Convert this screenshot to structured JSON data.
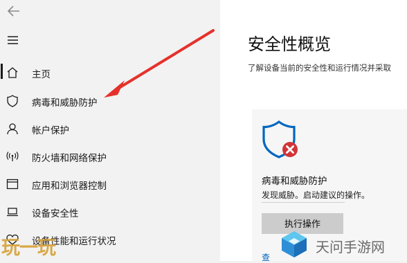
{
  "sidebar": {
    "back_icon": "back-arrow-icon",
    "menu_icon": "hamburger-menu-icon",
    "items": [
      {
        "label": "主页",
        "icon": "home-icon",
        "active": true
      },
      {
        "label": "病毒和威胁防护",
        "icon": "shield-icon"
      },
      {
        "label": "帐户保护",
        "icon": "person-icon"
      },
      {
        "label": "防火墙和网络保护",
        "icon": "wifi-antenna-icon"
      },
      {
        "label": "应用和浏览器控制",
        "icon": "app-window-icon"
      },
      {
        "label": "设备安全性",
        "icon": "laptop-icon"
      },
      {
        "label": "设备性能和运行状况",
        "icon": "heart-icon"
      }
    ]
  },
  "main": {
    "title": "安全性概览",
    "subtitle": "了解设备当前的安全性和运行情况并采取",
    "card": {
      "icon": "shield-error-icon",
      "title": "病毒和威胁防护",
      "description": "发现威胁。启动建议的操作。",
      "button_label": "执行操作",
      "link_label": "查"
    }
  },
  "watermarks": {
    "left_text": "玩一玩",
    "right_text": "天问手游网"
  },
  "colors": {
    "sidebar_bg": "#f2f2f2",
    "main_bg": "#ffffff",
    "card_bg": "#f6f6f6",
    "shield_blue": "#0067c0",
    "error_red": "#d13438",
    "annotation_arrow": "#e5312b",
    "button_gray": "#cccccc"
  }
}
